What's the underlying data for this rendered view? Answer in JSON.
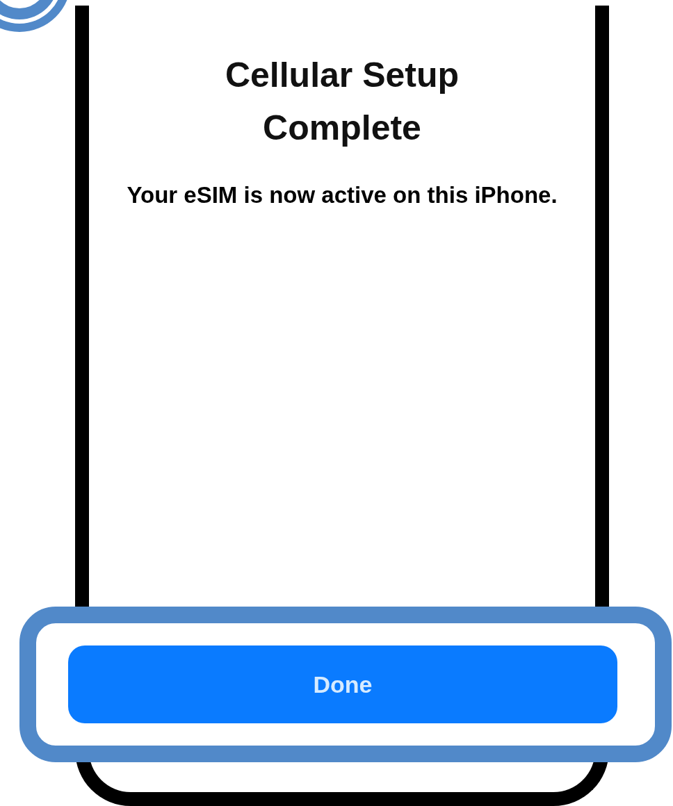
{
  "screen": {
    "title": "Cellular Setup Complete",
    "message": "Your eSIM is now active on this iPhone."
  },
  "done_button": {
    "label": "Done",
    "highlighted": true
  }
}
